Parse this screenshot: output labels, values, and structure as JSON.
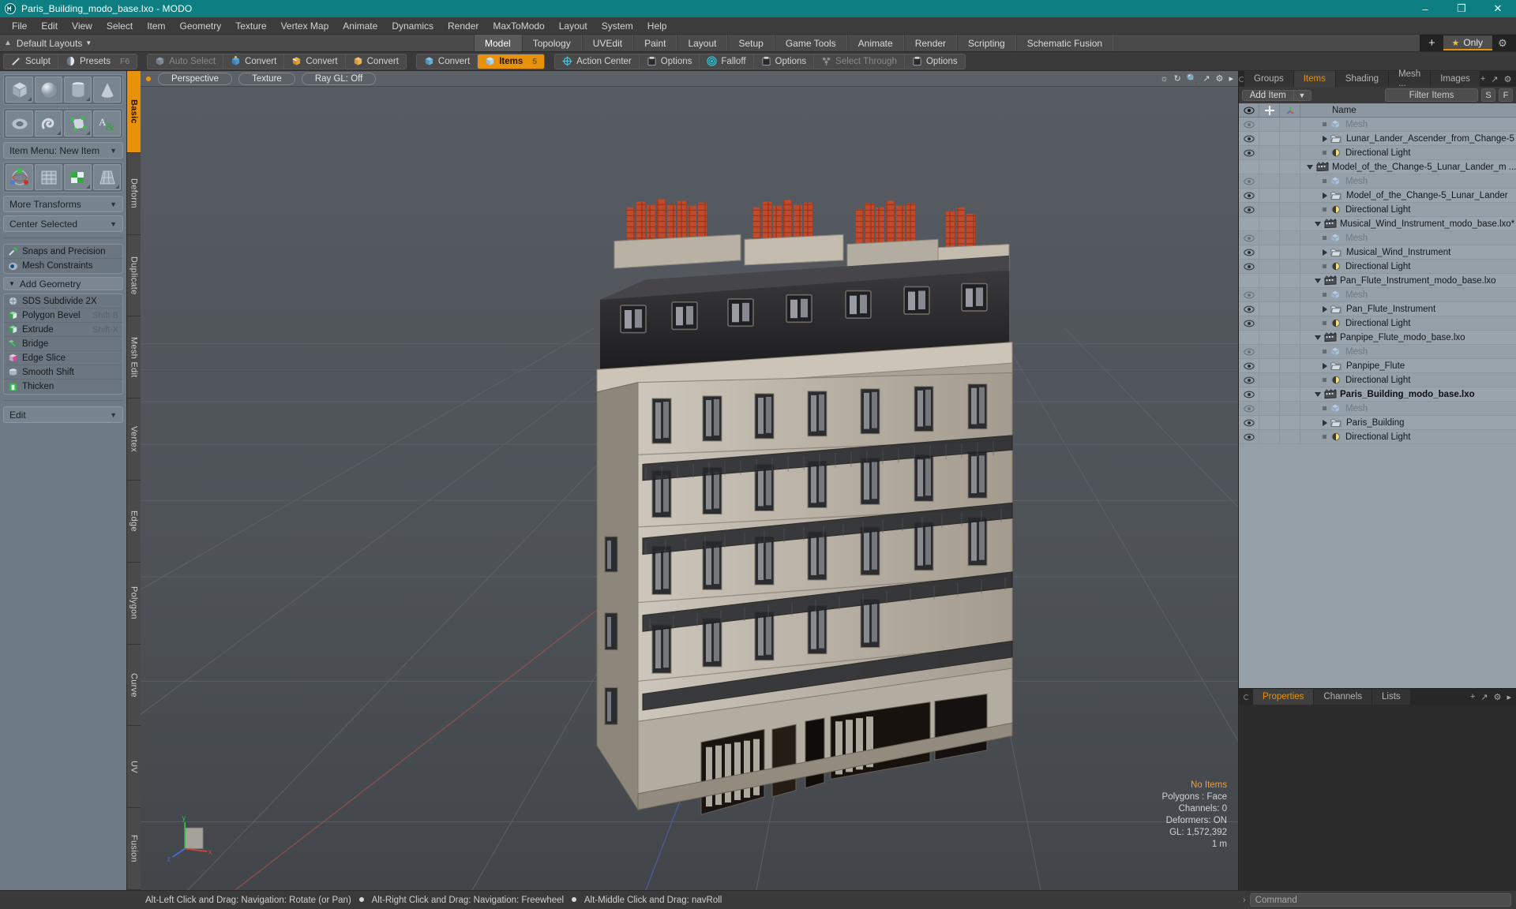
{
  "titlebar": {
    "title": "Paris_Building_modo_base.lxo - MODO",
    "logo": "modo-logo",
    "minimize": "–",
    "maximize": "❐",
    "close": "✕"
  },
  "menubar": {
    "items": [
      "File",
      "Edit",
      "View",
      "Select",
      "Item",
      "Geometry",
      "Texture",
      "Vertex Map",
      "Animate",
      "Dynamics",
      "Render",
      "MaxToModo",
      "Layout",
      "System",
      "Help"
    ]
  },
  "layoutbar": {
    "dropdown_label": "Default Layouts",
    "tabs": [
      {
        "label": "Model",
        "active": true
      },
      {
        "label": "Topology",
        "active": false
      },
      {
        "label": "UVEdit",
        "active": false
      },
      {
        "label": "Paint",
        "active": false
      },
      {
        "label": "Layout",
        "active": false
      },
      {
        "label": "Setup",
        "active": false
      },
      {
        "label": "Game Tools",
        "active": false
      },
      {
        "label": "Animate",
        "active": false
      },
      {
        "label": "Render",
        "active": false
      },
      {
        "label": "Scripting",
        "active": false
      },
      {
        "label": "Schematic Fusion",
        "active": false
      }
    ],
    "add_tab": "+",
    "only_label": "Only",
    "gear": "gear-icon"
  },
  "toolstrip": {
    "group1": [
      {
        "label": "Sculpt",
        "icon": "sculpt-icon",
        "state": "normal"
      },
      {
        "label": "Presets",
        "icon": "presets-icon",
        "state": "normal",
        "shortcut": "F6"
      }
    ],
    "group2": [
      {
        "label": "Auto Select",
        "icon": "cube-grey-icon",
        "state": "dim"
      },
      {
        "label": "Convert",
        "icon": "cube-vertex-icon",
        "state": "normal"
      },
      {
        "label": "Convert",
        "icon": "cube-edge-icon",
        "state": "normal"
      },
      {
        "label": "Convert",
        "icon": "cube-poly-icon",
        "state": "normal"
      }
    ],
    "group3": [
      {
        "label": "Convert",
        "icon": "cube-item-icon",
        "state": "normal"
      },
      {
        "label": "Items",
        "icon": "items-icon",
        "state": "selected",
        "shortcut": "5"
      }
    ],
    "group4": [
      {
        "label": "Action Center",
        "icon": "action-center-icon",
        "state": "normal"
      },
      {
        "label": "Options",
        "icon": "options-icon",
        "state": "normal"
      },
      {
        "label": "Falloff",
        "icon": "falloff-icon",
        "state": "normal"
      },
      {
        "label": "Options",
        "icon": "options-icon",
        "state": "normal"
      },
      {
        "label": "Select Through",
        "icon": "select-through-icon",
        "state": "dim"
      },
      {
        "label": "Options",
        "icon": "options-icon",
        "state": "normal"
      }
    ]
  },
  "leftpanel": {
    "primitives_row1": [
      "cube-primitive",
      "sphere-primitive",
      "cylinder-primitive",
      "cone-primitive"
    ],
    "primitives_row2": [
      "torus-primitive",
      "spiral-primitive",
      "polygon-primitive",
      "text-primitive"
    ],
    "item_menu": "Item Menu: New Item",
    "tools_row": [
      "transform-tool",
      "mesh-grid-tool",
      "uv-checker-tool",
      "taper-tool"
    ],
    "more_transforms": "More Transforms",
    "center_selected": "Center Selected",
    "snaps": "Snaps and Precision",
    "mesh_constraints": "Mesh Constraints",
    "add_geometry": "Add Geometry",
    "geometry_ops": [
      {
        "label": "SDS Subdivide 2X",
        "shortcut": "",
        "icon": "sds-icon"
      },
      {
        "label": "Polygon Bevel",
        "shortcut": "Shift-B",
        "icon": "bevel-icon"
      },
      {
        "label": "Extrude",
        "shortcut": "Shift-X",
        "icon": "extrude-icon"
      },
      {
        "label": "Bridge",
        "shortcut": "",
        "icon": "bridge-icon"
      },
      {
        "label": "Edge Slice",
        "shortcut": "",
        "icon": "slice-icon"
      },
      {
        "label": "Smooth Shift",
        "shortcut": "",
        "icon": "smooth-icon"
      },
      {
        "label": "Thicken",
        "shortcut": "",
        "icon": "thicken-icon"
      }
    ],
    "edit_dropdown": "Edit",
    "vtabs": [
      {
        "label": "Basic",
        "active": true
      },
      {
        "label": "Deform",
        "active": false
      },
      {
        "label": "Duplicate",
        "active": false
      },
      {
        "label": "Mesh Edit",
        "active": false
      },
      {
        "label": "Vertex",
        "active": false
      },
      {
        "label": "Edge",
        "active": false
      },
      {
        "label": "Polygon",
        "active": false
      },
      {
        "label": "Curve",
        "active": false
      },
      {
        "label": "UV",
        "active": false
      },
      {
        "label": "Fusion",
        "active": false
      }
    ]
  },
  "viewport": {
    "header": {
      "dot": "viewport-indicator",
      "pills": [
        "Perspective",
        "Texture",
        "Ray GL: Off"
      ],
      "right_icons": [
        "light-icon",
        "refresh-icon",
        "zoom-icon",
        "expand-icon",
        "gear-icon",
        "arrow-icon"
      ]
    },
    "stats": {
      "items_label": "No Items",
      "polygons": "Polygons : Face",
      "channels": "Channels: 0",
      "deformers": "Deformers: ON",
      "gl": "GL: 1,572,392",
      "scale": "1 m"
    },
    "axis": {
      "x": "x",
      "y": "y",
      "z": "z"
    }
  },
  "rightpanel": {
    "tabs": [
      {
        "label": "Groups",
        "active": false
      },
      {
        "label": "Items",
        "active": true
      },
      {
        "label": "Shading",
        "active": false
      },
      {
        "label": "Mesh ...",
        "active": false
      },
      {
        "label": "Images",
        "active": false
      }
    ],
    "tab_plus": "+",
    "controls": {
      "add_item": "Add Item",
      "add_item_caret": "▼",
      "filter_placeholder": "Filter Items",
      "btn_s": "S",
      "btn_f": "F"
    },
    "tree_header": {
      "eye": "eye-icon",
      "lock": "move-icon",
      "axis": "axis-icon",
      "name": "Name"
    },
    "tree_rows": [
      {
        "eye": true,
        "depth": 2,
        "type": "mesh",
        "label": "Mesh",
        "muted": true,
        "expander": "none"
      },
      {
        "eye": true,
        "depth": 2,
        "type": "folder",
        "label": "Lunar_Lander_Ascender_from_Change-5",
        "muted": false,
        "expander": "right"
      },
      {
        "eye": true,
        "depth": 2,
        "type": "light",
        "label": "Directional Light",
        "muted": false,
        "expander": "none"
      },
      {
        "eye": false,
        "depth": 1,
        "type": "scene",
        "label": "Model_of_the_Change-5_Lunar_Lander_m ...",
        "muted": false,
        "expander": "down"
      },
      {
        "eye": true,
        "depth": 2,
        "type": "mesh",
        "label": "Mesh",
        "muted": true,
        "expander": "none"
      },
      {
        "eye": true,
        "depth": 2,
        "type": "folder",
        "label": "Model_of_the_Change-5_Lunar_Lander",
        "muted": false,
        "expander": "right"
      },
      {
        "eye": true,
        "depth": 2,
        "type": "light",
        "label": "Directional Light",
        "muted": false,
        "expander": "none"
      },
      {
        "eye": false,
        "depth": 1,
        "type": "scene",
        "label": "Musical_Wind_Instrument_modo_base.lxo*",
        "muted": false,
        "expander": "down"
      },
      {
        "eye": true,
        "depth": 2,
        "type": "mesh",
        "label": "Mesh",
        "muted": true,
        "expander": "none"
      },
      {
        "eye": true,
        "depth": 2,
        "type": "folder",
        "label": "Musical_Wind_Instrument",
        "muted": false,
        "expander": "right"
      },
      {
        "eye": true,
        "depth": 2,
        "type": "light",
        "label": "Directional Light",
        "muted": false,
        "expander": "none"
      },
      {
        "eye": false,
        "depth": 1,
        "type": "scene",
        "label": "Pan_Flute_Instrument_modo_base.lxo",
        "muted": false,
        "expander": "down"
      },
      {
        "eye": true,
        "depth": 2,
        "type": "mesh",
        "label": "Mesh",
        "muted": true,
        "expander": "none"
      },
      {
        "eye": true,
        "depth": 2,
        "type": "folder",
        "label": "Pan_Flute_Instrument",
        "muted": false,
        "expander": "right"
      },
      {
        "eye": true,
        "depth": 2,
        "type": "light",
        "label": "Directional Light",
        "muted": false,
        "expander": "none"
      },
      {
        "eye": false,
        "depth": 1,
        "type": "scene",
        "label": "Panpipe_Flute_modo_base.lxo",
        "muted": false,
        "expander": "down"
      },
      {
        "eye": true,
        "depth": 2,
        "type": "mesh",
        "label": "Mesh",
        "muted": true,
        "expander": "none"
      },
      {
        "eye": true,
        "depth": 2,
        "type": "folder",
        "label": "Panpipe_Flute",
        "muted": false,
        "expander": "right"
      },
      {
        "eye": true,
        "depth": 2,
        "type": "light",
        "label": "Directional Light",
        "muted": false,
        "expander": "none"
      },
      {
        "eye": true,
        "depth": 1,
        "type": "scene",
        "label": "Paris_Building_modo_base.lxo",
        "muted": false,
        "bold": true,
        "expander": "down"
      },
      {
        "eye": true,
        "depth": 2,
        "type": "mesh",
        "label": "Mesh",
        "muted": true,
        "expander": "none"
      },
      {
        "eye": true,
        "depth": 2,
        "type": "folder",
        "label": "Paris_Building",
        "muted": false,
        "expander": "right"
      },
      {
        "eye": true,
        "depth": 2,
        "type": "light",
        "label": "Directional Light",
        "muted": false,
        "expander": "none"
      }
    ],
    "bottom_tabs": [
      {
        "label": "Properties",
        "active": true
      },
      {
        "label": "Channels",
        "active": false
      },
      {
        "label": "Lists",
        "active": false
      }
    ],
    "bottom_tab_plus": "+"
  },
  "statusbar": {
    "hint_1": "Alt-Left Click and Drag: Navigation: Rotate (or Pan)",
    "hint_2": "Alt-Right Click and Drag: Navigation: Freewheel",
    "hint_3": "Alt-Middle Click and Drag: navRoll",
    "command_placeholder": "Command",
    "command_arrow": "›"
  },
  "colors": {
    "accent": "#e8920c",
    "title_bg": "#0d7f82",
    "panel_bg": "#3a3a3a",
    "tree_bg": "#96a0a9",
    "left_panel": "#6e7a85",
    "chimney_red": "#c0452a"
  }
}
